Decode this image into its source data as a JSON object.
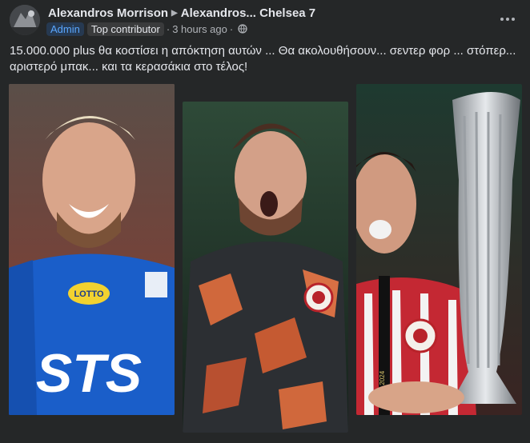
{
  "post": {
    "author": "Alexandros Morrison",
    "group": "Alexandros... Chelsea 7",
    "badge_admin": "Admin",
    "badge_top": "Top contributor",
    "time": "3 hours ago",
    "separator": "·",
    "text": "15.000.000 plus θα κοστίσει η απόκτηση αυτών ... Θα ακολουθήσουν... σεντερ φορ ... στόπερ... αριστερό μπακ... και τα κερασάκια στο τέλος!"
  },
  "photos": [
    {
      "label": "STS",
      "sponsor": "LOTTO"
    },
    {
      "label": ""
    },
    {
      "label": "FINAL 2024"
    }
  ],
  "colors": {
    "background": "#252728",
    "admin_badge_text": "#5aa7ff",
    "text_primary": "#e4e6eb",
    "text_secondary": "#b0b3b8"
  },
  "icons": [
    "avatar",
    "arrow-right-icon",
    "globe-icon",
    "more-options-icon"
  ]
}
